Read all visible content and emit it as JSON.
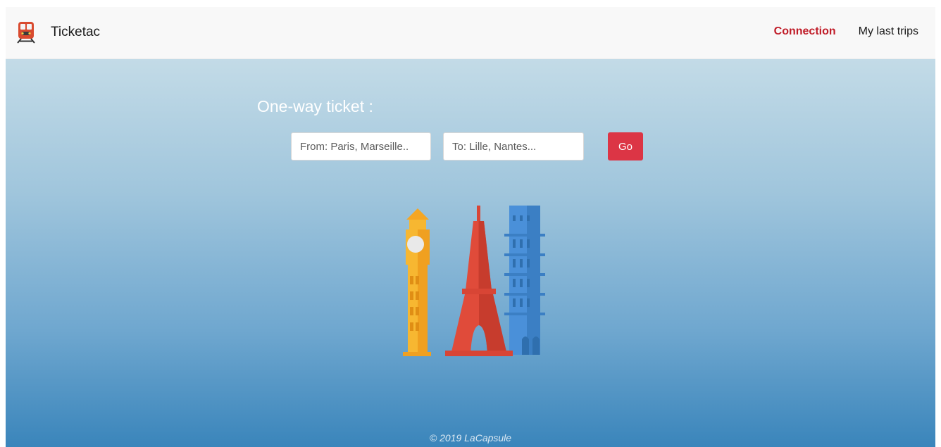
{
  "brand": {
    "name": "Ticketac",
    "icon": "train-icon"
  },
  "nav": {
    "connection": "Connection",
    "last_trips": "My last trips"
  },
  "hero": {
    "title": "One-way ticket :",
    "illustration": "landmarks-illustration"
  },
  "search": {
    "from_placeholder": "From: Paris, Marseille..",
    "from_value": "",
    "to_placeholder": "To: Lille, Nantes...",
    "to_value": "",
    "go_label": "Go"
  },
  "footer": {
    "copyright": "© 2019 LaCapsule"
  },
  "colors": {
    "accent": "#c01c28",
    "button": "#dc3545",
    "navbar_bg": "#f8f8f8",
    "hero_top": "#c3dbe7",
    "hero_bottom": "#3a85bb"
  }
}
